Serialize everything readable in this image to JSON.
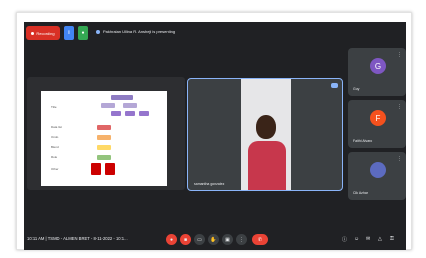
{
  "topbar": {
    "recording_label": "Recording",
    "presenting_text": "Pakhraian Ullina R. Ansheji is presenting"
  },
  "main_tile": {
    "name": "samantha gonzalez"
  },
  "side_tiles": [
    {
      "initial": "G",
      "name": "Guy",
      "color": "#7e57c2"
    },
    {
      "initial": "F",
      "name": "Faithi Alvaro",
      "color": "#f4511e"
    },
    {
      "initial": "",
      "name": "Cik Azhar",
      "color": "#5c6bc0"
    }
  ],
  "bottombar": {
    "time_text": "10:11 AM  |  TSMD - ALMEN BRET - 8-11-2022 - 10:1..."
  },
  "slide": {
    "row_labels": [
      "Title",
      "Data list",
      "Ondo",
      "Blend",
      "Role",
      "Other"
    ]
  },
  "colors": {
    "meet_bg": "#202124",
    "tile_bg": "#3c4043",
    "accent_blue": "#8ab4f8",
    "red": "#ea4335"
  }
}
